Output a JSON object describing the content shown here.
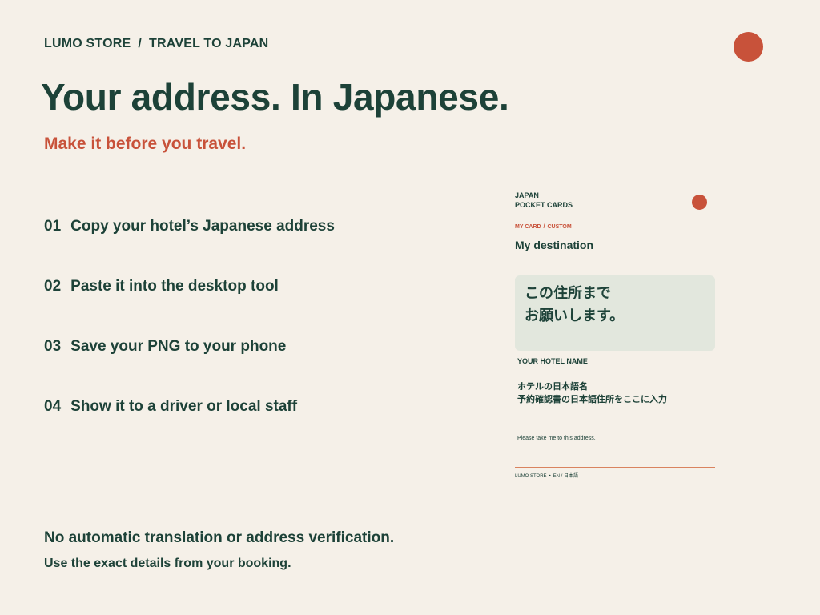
{
  "colors": {
    "background": "#f5f0e8",
    "primary": "#1d4238",
    "accent": "#c8523a",
    "card_box": "#e2e7dd",
    "card_rule": "#d9835f"
  },
  "header": {
    "breadcrumb": {
      "store": "LUMO STORE",
      "separator": "/",
      "section": "TRAVEL TO JAPAN"
    }
  },
  "hero": {
    "title": "Your address. In Japanese.",
    "subtitle": "Make it before you travel."
  },
  "steps": [
    {
      "number": "01",
      "text": "Copy your hotel’s Japanese address"
    },
    {
      "number": "02",
      "text": "Paste it into the desktop tool"
    },
    {
      "number": "03",
      "text": "Save your PNG to your phone"
    },
    {
      "number": "04",
      "text": "Show it to a driver or local staff"
    }
  ],
  "card": {
    "brand_line1": "JAPAN",
    "brand_line2": "POCKET CARDS",
    "tab_primary": "MY CARD",
    "tab_separator": "/",
    "tab_secondary": "CUSTOM",
    "heading": "My destination",
    "jp_request_line1": "この住所まで",
    "jp_request_line2": "お願いします。",
    "hotel_label": "YOUR HOTEL NAME",
    "hotel_jp_line1": "ホテルの日本語名",
    "hotel_jp_line2": "予約確認書の日本語住所をここに入力",
    "phrase_en": "Please take me to this address.",
    "footer_store": "LUMO STORE",
    "footer_dot": "•",
    "footer_lang": "EN / 日本語"
  },
  "disclaimer": {
    "main": "No automatic translation or address verification.",
    "sub": "Use the exact details from your booking."
  }
}
